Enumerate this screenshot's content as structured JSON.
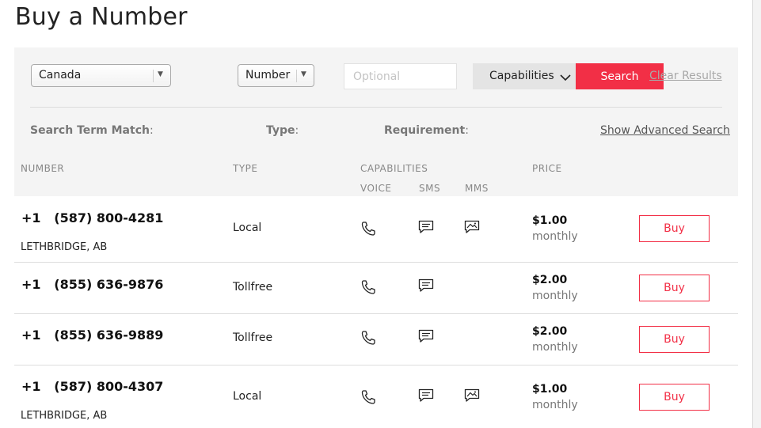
{
  "page": {
    "title": "Buy a Number"
  },
  "search": {
    "country": "Canada",
    "number_type": "Number",
    "input_placeholder": "Optional",
    "input_value": "",
    "capabilities_label": "Capabilities",
    "search_label": "Search",
    "clear_label": "Clear Results",
    "filters": {
      "search_term_match": "Search Term Match",
      "type": "Type",
      "requirement": "Requirement",
      "colon": ":"
    },
    "advanced_label": "Show Advanced Search"
  },
  "columns": {
    "number": "NUMBER",
    "type": "TYPE",
    "capabilities": "CAPABILITIES",
    "voice": "VOICE",
    "sms": "SMS",
    "mms": "MMS",
    "price": "PRICE"
  },
  "results": [
    {
      "phone": "+1   (587) 800-4281",
      "location": "LETHBRIDGE, AB",
      "type": "Local",
      "voice": true,
      "sms": true,
      "mms": true,
      "price": "$1.00",
      "period": "monthly",
      "buy_label": "Buy"
    },
    {
      "phone": "+1   (855) 636-9876",
      "location": "",
      "type": "Tollfree",
      "voice": true,
      "sms": true,
      "mms": false,
      "price": "$2.00",
      "period": "monthly",
      "buy_label": "Buy"
    },
    {
      "phone": "+1   (855) 636-9889",
      "location": "",
      "type": "Tollfree",
      "voice": true,
      "sms": true,
      "mms": false,
      "price": "$2.00",
      "period": "monthly",
      "buy_label": "Buy"
    },
    {
      "phone": "+1   (587) 800-4307",
      "location": "LETHBRIDGE, AB",
      "type": "Local",
      "voice": true,
      "sms": true,
      "mms": true,
      "price": "$1.00",
      "period": "monthly",
      "buy_label": "Buy"
    }
  ],
  "icons": {
    "voice": "phone-icon",
    "sms": "message-icon",
    "mms": "image-message-icon",
    "capabilities_toggle": "chevron-down-icon"
  },
  "colors": {
    "accent": "#f22f46",
    "panel_bg": "#f4f4f4"
  }
}
